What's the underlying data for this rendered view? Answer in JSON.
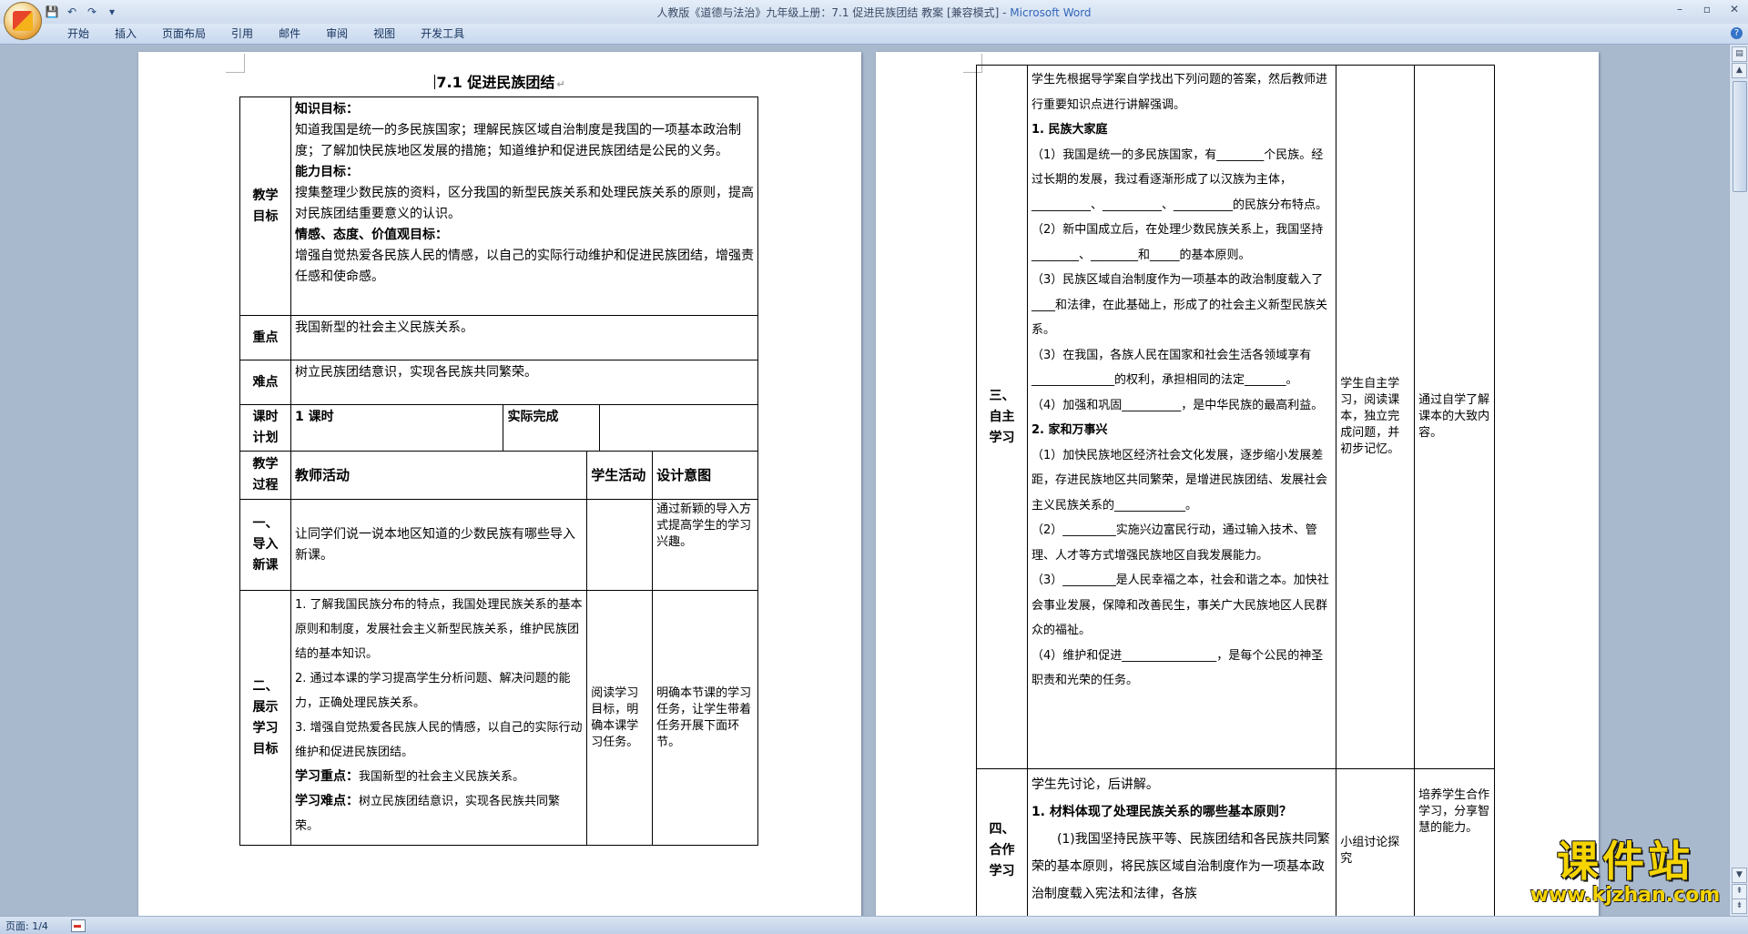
{
  "window": {
    "title": "人教版《道德与法治》九年级上册：7.1 促进民族团结 教案 [兼容模式] - ",
    "app_name": "Microsoft Word",
    "controls": [
      "–",
      "▫",
      "✕"
    ]
  },
  "quick_access": [
    "save-icon",
    "undo-icon",
    "redo-icon",
    "customize-icon"
  ],
  "ribbon_tabs": [
    "开始",
    "插入",
    "页面布局",
    "引用",
    "邮件",
    "审阅",
    "视图",
    "开发工具"
  ],
  "status": {
    "page": "页面: 1/4"
  },
  "watermark": {
    "text": "课件站",
    "url": "www.kjzhan.com"
  },
  "page1": {
    "title": "7.1  促进民族团结",
    "objectives_label": "教学\n目标",
    "knowledge_head": "知识目标：",
    "knowledge_text": "知道我国是统一的多民族国家；理解民族区域自治制度是我国的一项基本政治制度；了解加快民族地区发展的措施；知道维护和促进民族团结是公民的义务。",
    "ability_head": "能力目标：",
    "ability_text": "搜集整理少数民族的资料，区分我国的新型民族关系和处理民族关系的原则，提高对民族团结重要意义的认识。",
    "emotion_head": "情感、态度、价值观目标：",
    "emotion_text": "增强自觉热爱各民族人民的情感，以自己的实际行动维护和促进民族团结，增强责任感和使命感。",
    "key_label": "重点",
    "key_text": "我国新型的社会主义民族关系。",
    "difficulty_label": "难点",
    "difficulty_text": "树立民族团结意识，实现各民族共同繁荣。",
    "hours_label": "课时\n计划",
    "hours_value": "1 课时",
    "actual_label": "实际完成",
    "process_label": "教学\n过程",
    "col_teacher": "教师活动",
    "col_student": "学生活动",
    "col_design": "设计意图",
    "s1_label": "一、\n导入\n新课",
    "s1_teacher": "让同学们说一说本地区知道的少数民族有哪些导入新课。",
    "s1_design": "通过新颖的导入方式提高学生的学习兴趣。",
    "s2_label": "二、\n展示\n学习\n目标",
    "s2_items": [
      "1. 了解我国民族分布的特点，我国处理民族关系的基本原则和制度，发展社会主义新型民族关系，维护民族团结的基本知识。",
      "2. 通过本课的学习提高学生分析问题、解决问题的能力，正确处理民族关系。",
      "3. 增强自觉热爱各民族人民的情感，以自己的实际行动维护和促进民族团结。"
    ],
    "s2_key_head": "学习重点：",
    "s2_key_text": "我国新型的社会主义民族关系。",
    "s2_diff_head": "学习难点：",
    "s2_diff_text": "树立民族团结意识，实现各民族共同繁荣。",
    "s2_student": "阅读学习目标，明确本课学习任务。",
    "s2_design": "明确本节课的学习任务，让学生带着任务开展下面环节。"
  },
  "page2": {
    "s3_label": "三、\n自主\n学习",
    "s3_intro": "学生先根据导学案自学找出下列问题的答案，然后教师进行重要知识点进行讲解强调。",
    "s3_h1": "1. 民族大家庭",
    "s3_p1": [
      "（1）我国是统一的多民族国家，有________个民族。经过长期的发展，我过看逐渐形成了以汉族为主体，__________、__________、__________的民族分布特点。",
      "（2）新中国成立后，在处理少数民族关系上，我国坚持________、________和_____的基本原则。",
      "（3）民族区域自治制度作为一项基本的政治制度载入了____和法律，在此基础上，形成了的社会主义新型民族关系。",
      "（3）在我国，各族人民在国家和社会生活各领域享有______________的权利，承担相同的法定_______。",
      "（4）加强和巩固__________，是中华民族的最高利益。"
    ],
    "s3_h2": "2. 家和万事兴",
    "s3_p2": [
      "（1）加快民族地区经济社会文化发展，逐步缩小发展差距，存进民族地区共同繁荣，是增进民族团结、发展社会主义民族关系的____________。",
      "（2）_________实施兴边富民行动，通过输入技术、管理、人才等方式增强民族地区自我发展能力。",
      "（3）_________是人民幸福之本，社会和谐之本。加快社会事业发展，保障和改善民生，事关广大民族地区人民群众的福祉。",
      "（4）维护和促进________________，是每个公民的神圣职责和光荣的任务。"
    ],
    "s3_student": "学生自主学习，阅读课本，独立完成问题，并初步记忆。",
    "s3_design": "通过自学了解课本的大致内容。",
    "s4_label": "四、\n合作\n学习",
    "s4_intro": "学生先讨论，后讲解。",
    "s4_q1": "1. 材料体现了处理民族关系的哪些基本原则？",
    "s4_a1": "(1)我国坚持民族平等、民族团结和各民族共同繁荣的基本原则，将民族区域自治制度作为一项基本政治制度载入宪法和法律，各族",
    "s4_student": "小组讨论探究",
    "s4_design": "培养学生合作学习，分享智慧的能力。"
  }
}
